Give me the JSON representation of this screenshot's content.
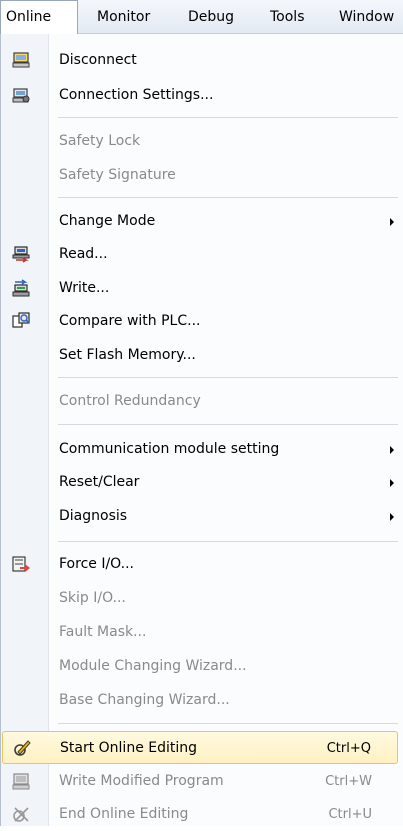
{
  "menubar": {
    "items": [
      {
        "label": "Online"
      },
      {
        "label": "Monitor"
      },
      {
        "label": "Debug"
      },
      {
        "label": "Tools"
      },
      {
        "label": "Window"
      }
    ]
  },
  "menu": {
    "disconnect": "Disconnect",
    "connection_settings": "Connection Settings...",
    "safety_lock": "Safety Lock",
    "safety_signature": "Safety Signature",
    "change_mode": "Change Mode",
    "read": "Read...",
    "write": "Write...",
    "compare_with_plc": "Compare with PLC...",
    "set_flash_memory": "Set Flash Memory...",
    "control_redundancy": "Control Redundancy",
    "communication_module_setting": "Communication module setting",
    "reset_clear": "Reset/Clear",
    "diagnosis": "Diagnosis",
    "force_io": "Force I/O...",
    "skip_io": "Skip I/O...",
    "fault_mask": "Fault Mask...",
    "module_changing_wizard": "Module Changing Wizard...",
    "base_changing_wizard": "Base Changing Wizard...",
    "start_online_editing": "Start Online Editing",
    "start_online_editing_shortcut": "Ctrl+Q",
    "write_modified_program": "Write Modified Program",
    "write_modified_program_shortcut": "Ctrl+W",
    "end_online_editing": "End Online Editing",
    "end_online_editing_shortcut": "Ctrl+U"
  },
  "icons": {
    "disconnect": "disconnect-icon",
    "connection_settings": "connection-settings-icon",
    "read": "read-icon",
    "write": "write-icon",
    "compare": "compare-icon",
    "force_io": "force-io-icon",
    "start_online_editing": "start-online-editing-icon",
    "write_modified_program": "write-modified-program-icon",
    "end_online_editing": "end-online-editing-icon"
  },
  "colors": {
    "highlight_bg": "#fff1c2",
    "highlight_border": "#e3c66c",
    "disabled_text": "#8a8a8a",
    "menubar_bg": "#e3e9f3"
  }
}
